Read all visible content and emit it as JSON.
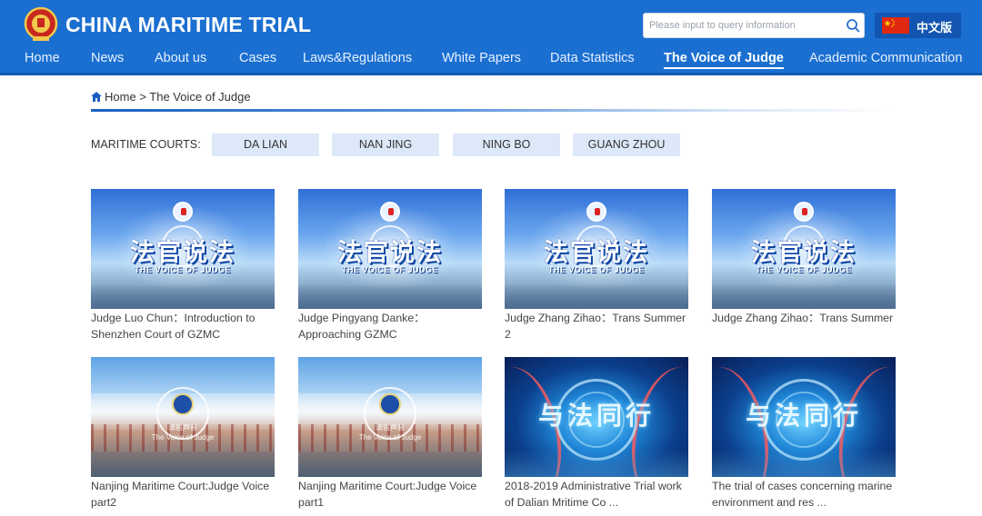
{
  "header": {
    "title": "CHINA MARITIME TRIAL",
    "search_placeholder": "Please input to query information",
    "lang_label": "中文版",
    "colors": {
      "header_bg": "#1a6fd0",
      "lang_button": "#1256b2"
    }
  },
  "nav": {
    "items": [
      {
        "label": "Home",
        "active": false
      },
      {
        "label": "News",
        "active": false
      },
      {
        "label": "About us",
        "active": false
      },
      {
        "label": "Cases",
        "active": false
      },
      {
        "label": "Laws&Regulations",
        "active": false
      },
      {
        "label": "White Papers",
        "active": false
      },
      {
        "label": "Data Statistics",
        "active": false
      },
      {
        "label": "The Voice of Judge",
        "active": true
      },
      {
        "label": "Academic Communication",
        "active": false
      }
    ]
  },
  "breadcrumb": {
    "home": "Home",
    "separator": ">",
    "current": "The Voice of Judge"
  },
  "courts": {
    "label": "MARITIME COURTS:",
    "items": [
      "DA LIAN",
      "NAN JING",
      "NING BO",
      "GUANG ZHOU"
    ]
  },
  "videos": [
    {
      "title": "Judge Luo Chun：Introduction to Shenzhen Court of GZMC",
      "thumb": {
        "big": "法官说法",
        "small": "THE VOICE OF JUDGE"
      }
    },
    {
      "title": "Judge Pingyang Danke：Approaching GZMC",
      "thumb": {
        "big": "法官说法",
        "small": "THE VOICE OF JUDGE"
      }
    },
    {
      "title": "Judge Zhang Zihao：Trans Summer 2",
      "thumb": {
        "big": "法官说法",
        "small": "THE VOICE OF JUDGE"
      }
    },
    {
      "title": "Judge Zhang Zihao：Trans Summer",
      "thumb": {
        "big": "法官说法",
        "small": "THE VOICE OF JUDGE"
      }
    },
    {
      "title": "Nanjing Maritime Court:Judge Voice part2",
      "thumb": {
        "line1": "法官声音",
        "line2": "The Voice of Judge"
      }
    },
    {
      "title": "Nanjing Maritime Court:Judge Voice part1",
      "thumb": {
        "line1": "法官声音",
        "line2": "The Voice of Judge"
      }
    },
    {
      "title": "2018-2019 Administrative Trial work of Dalian Mritime Co ...",
      "thumb": {
        "big": "与法同行"
      }
    },
    {
      "title": "The trial of cases concerning marine environment and res ...",
      "thumb": {
        "big": "与法同行"
      }
    }
  ],
  "icons": {
    "logo": "court-emblem-icon",
    "search": "search-icon",
    "flag": "china-flag-icon",
    "home": "home-icon"
  }
}
